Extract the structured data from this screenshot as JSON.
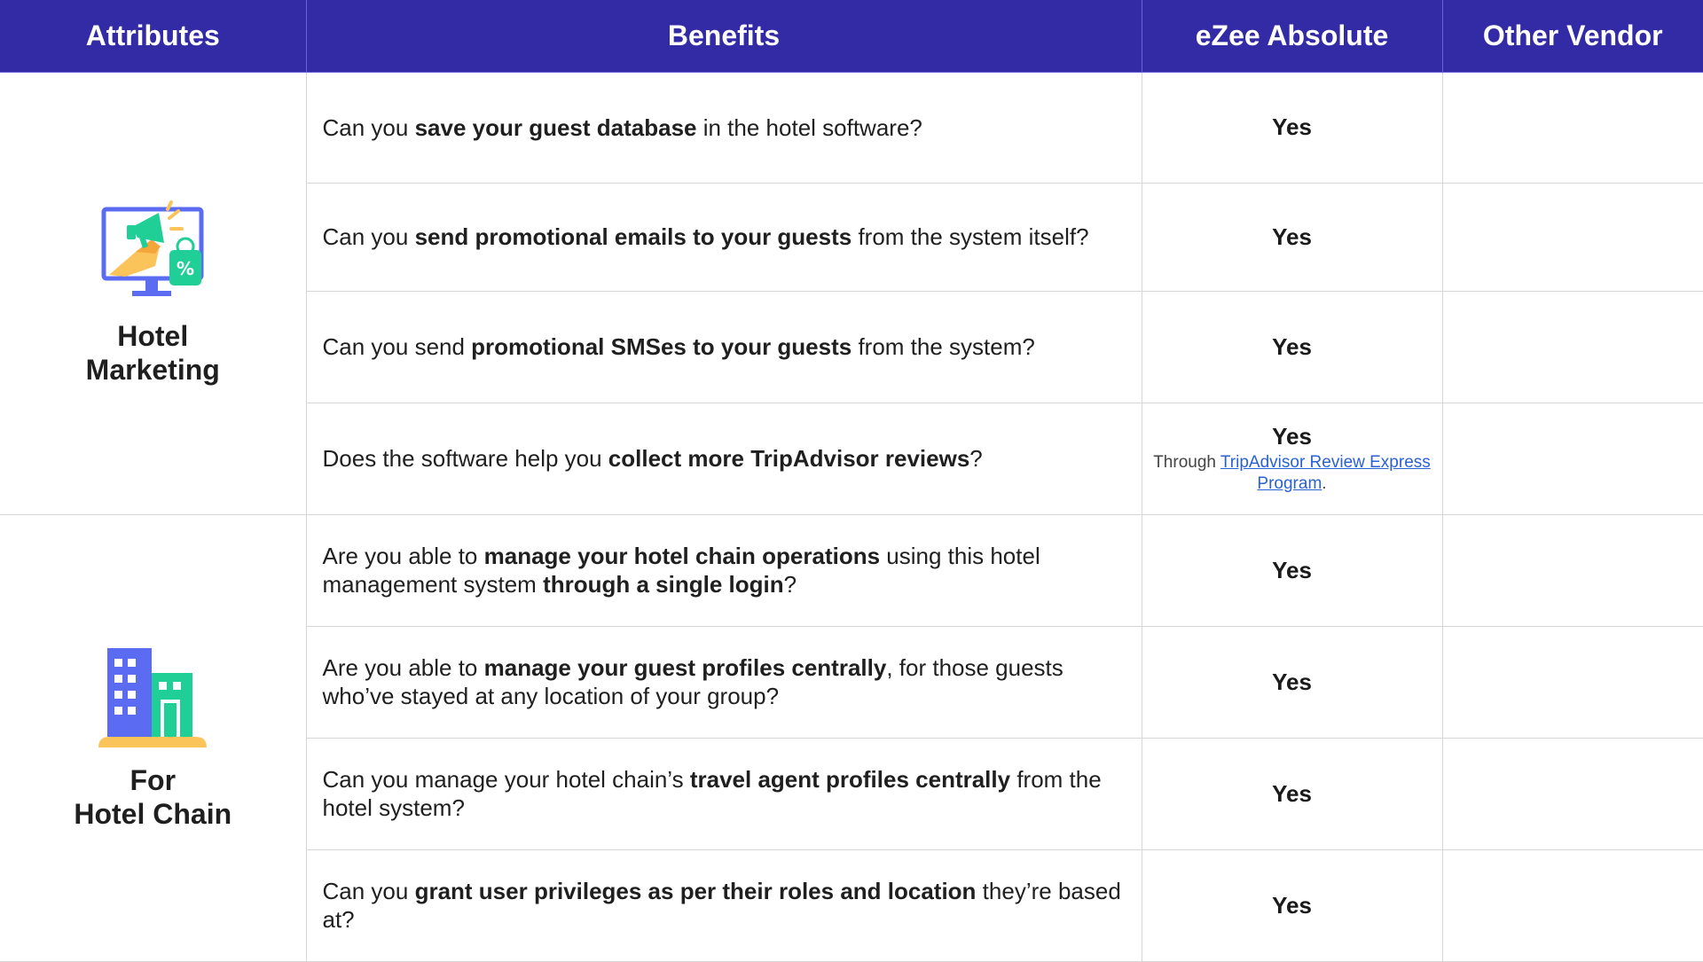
{
  "header": {
    "attributes": "Attributes",
    "benefits": "Benefits",
    "ezee": "eZee Absolute",
    "other": "Other Vendor"
  },
  "groups": [
    {
      "title_line1": "Hotel",
      "title_line2": "Marketing",
      "icon": "marketing-megaphone-monitor-icon",
      "rows": [
        {
          "pre": "Can you ",
          "bold": "save your guest database",
          "post": " in the hotel software?",
          "answer": "Yes"
        },
        {
          "pre": "Can you ",
          "bold": "send promotional emails to your guests",
          "post": " from the system itself?",
          "answer": "Yes"
        },
        {
          "pre": "Can you send ",
          "bold": "promotional SMSes to your guests",
          "post": " from the system?",
          "answer": "Yes"
        },
        {
          "pre": "Does the software help you ",
          "bold": "collect more TripAdvisor reviews",
          "post": "?",
          "answer": "Yes",
          "note_pre": "Through ",
          "note_link": "TripAdvisor Review Express Program",
          "note_post": "."
        }
      ]
    },
    {
      "title_line1": "For",
      "title_line2": "Hotel Chain",
      "icon": "hotel-buildings-icon",
      "rows": [
        {
          "pre": "Are you able to ",
          "bold": "manage your hotel chain operations",
          "mid": " using this hotel management system ",
          "bold2": "through a single login",
          "post": "?",
          "answer": "Yes"
        },
        {
          "pre": "Are you able to ",
          "bold": "manage your guest profiles centrally",
          "post": ", for those guests who’ve stayed at any location of your group?",
          "answer": "Yes"
        },
        {
          "pre": "Can you manage your hotel chain’s ",
          "bold": "travel agent profiles centrally",
          "post": " from the hotel system?",
          "answer": "Yes"
        },
        {
          "pre": "Can you ",
          "bold": "grant user privileges as per their roles and location",
          "post": " they’re based at?",
          "answer": "Yes"
        }
      ]
    }
  ],
  "colors": {
    "header_bg": "#332aa6",
    "accent_blue": "#5b6cf2",
    "accent_green": "#1fcf96",
    "accent_yellow": "#fbc45a",
    "link": "#2a62d4"
  }
}
